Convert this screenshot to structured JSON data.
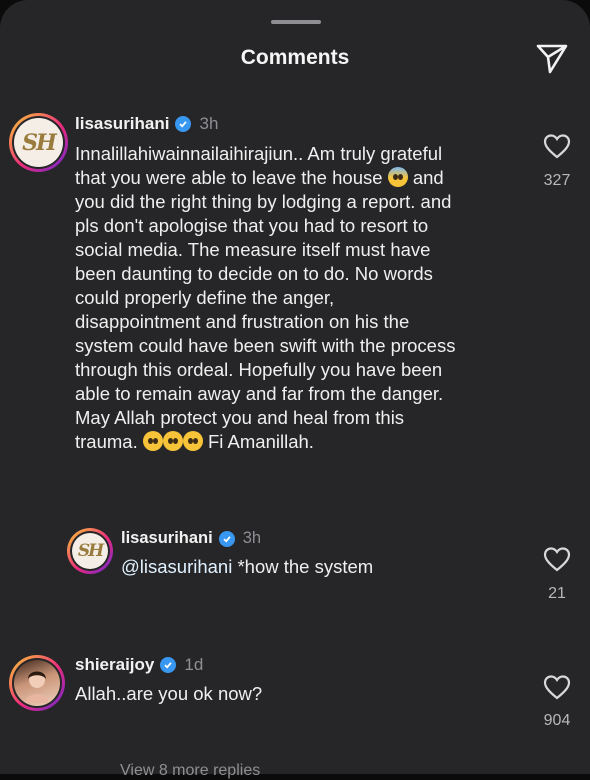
{
  "header": {
    "title": "Comments"
  },
  "comments": [
    {
      "username": "lisasurihani",
      "time": "3h",
      "lines": [
        "Innalillahiwainnailaihirajiun.. Am truly grateful",
        "that you were able to leave the house",
        "and",
        "you did the right thing by lodging a report. and",
        "pls don't apologise that you had to resort to",
        "social media. The measure itself must have",
        "been daunting to decide on to do. No words",
        "could properly define the anger,",
        "disappointment and frustration on his the",
        "system could have been swift with the process",
        "through this ordeal. Hopefully you have been",
        "able to remain away and far from the danger.",
        "May Allah protect you and heal from this",
        "trauma.",
        "Fi Amanillah."
      ],
      "likes": "327"
    },
    {
      "username": "lisasurihani",
      "time": "3h",
      "mention": "@lisasurihani",
      "text": " *how the system",
      "likes": "21"
    },
    {
      "username": "shieraijoy",
      "time": "1d",
      "text": "Allah..are you ok now?",
      "likes": "904"
    }
  ],
  "footer": {
    "view_more": "View 8 more replies"
  },
  "icons": {
    "share": "paper-plane-icon",
    "like": "heart-outline-icon",
    "verified": "verified-badge-icon"
  },
  "colors": {
    "sheet": "#262628",
    "verified": "#3897f0",
    "ring_start": "#f9ce34",
    "ring_end": "#6228d7"
  }
}
